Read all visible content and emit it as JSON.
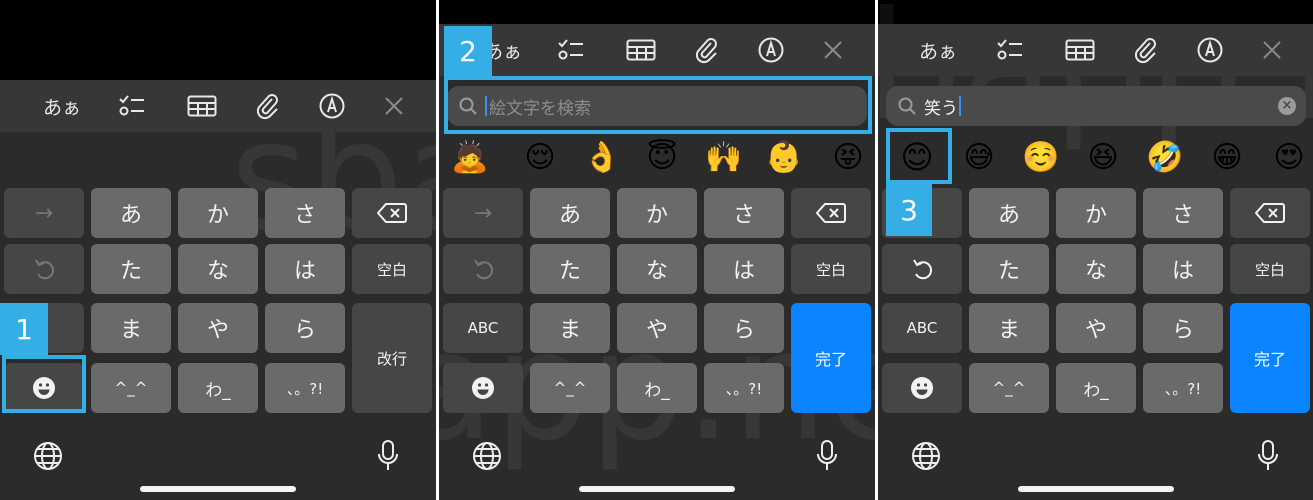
{
  "toolbar": {
    "kana_label": "あぁ",
    "icons": [
      "checklist-icon",
      "table-icon",
      "paperclip-icon",
      "markup-pen-icon",
      "close-icon"
    ]
  },
  "keys": {
    "arrow": "→",
    "a": "あ",
    "ka": "か",
    "sa": "さ",
    "ta": "た",
    "na": "な",
    "ha": "は",
    "ma": "ま",
    "ya": "や",
    "ra": "ら",
    "kaomoji": "^_^",
    "wa": "わ_",
    "punct": "、。?!",
    "space": "空白",
    "return_label": "改行",
    "abc": "ABC",
    "done": "完了"
  },
  "search": {
    "placeholder": "絵文字を検索",
    "query": "笑う"
  },
  "emoji_panel2": [
    "🙇",
    "😌",
    "👌",
    "😇",
    "🙌",
    "👶",
    "😝"
  ],
  "emoji_panel3": [
    "😊",
    "😅",
    "☺️",
    "😆",
    "🤣",
    "😁",
    "😍"
  ],
  "steps": [
    "1",
    "2",
    "3"
  ],
  "watermark": "sbapp.net",
  "colors": {
    "highlight": "#35aee6",
    "accent": "#0a84ff"
  }
}
